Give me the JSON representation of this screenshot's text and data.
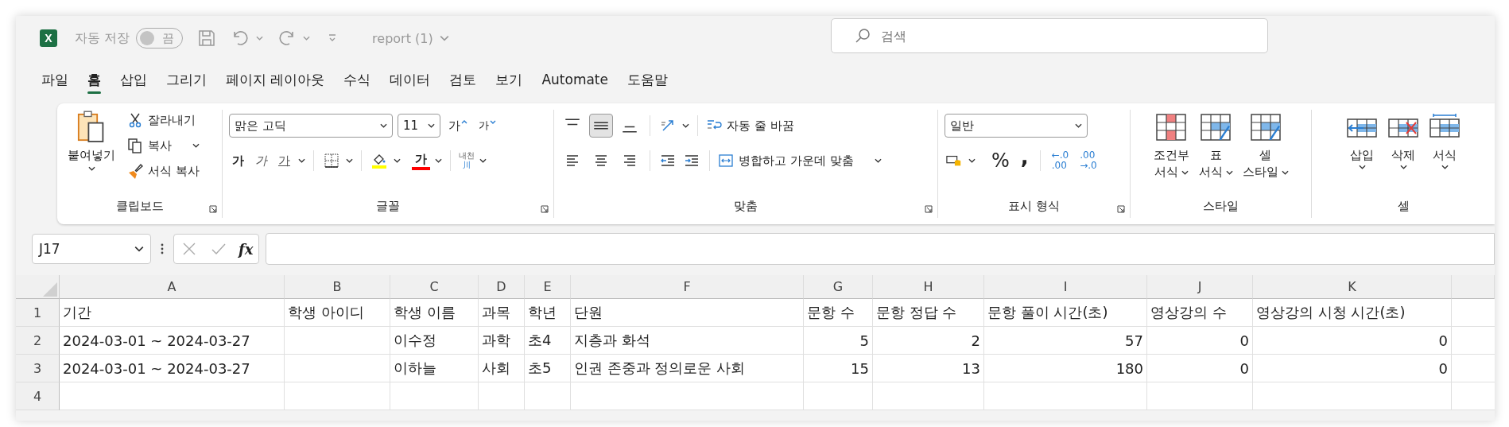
{
  "title_bar": {
    "app_logo": "X",
    "autosave_label": "자동 저장",
    "autosave_toggle": {
      "on": false,
      "label": "끔"
    },
    "document_title": "report (1)",
    "search": {
      "placeholder": "검색"
    }
  },
  "menu_tabs": [
    {
      "label": "파일",
      "selected": false
    },
    {
      "label": "홈",
      "selected": true
    },
    {
      "label": "삽입",
      "selected": false
    },
    {
      "label": "그리기",
      "selected": false
    },
    {
      "label": "페이지 레이아웃",
      "selected": false
    },
    {
      "label": "수식",
      "selected": false
    },
    {
      "label": "데이터",
      "selected": false
    },
    {
      "label": "검토",
      "selected": false
    },
    {
      "label": "보기",
      "selected": false
    },
    {
      "label": "Automate",
      "selected": false
    },
    {
      "label": "도움말",
      "selected": false
    }
  ],
  "ribbon": {
    "groups": [
      {
        "kind": "clipboard",
        "label": "클립보드",
        "launcher": true,
        "paste": "붙여넣기",
        "cut": "잘라내기",
        "copy": "복사",
        "format_painter": "서식 복사"
      },
      {
        "kind": "font",
        "label": "글꼴",
        "launcher": true,
        "font": "맑은 고딕",
        "size": "11",
        "grow": "가",
        "shrink": "가",
        "bold": "가",
        "italic": "가",
        "underline": "가",
        "font_color": "가",
        "phonetic": [
          "내천",
          "川"
        ]
      },
      {
        "kind": "alignment",
        "label": "맞춤",
        "launcher": true,
        "vertical": [
          {
            "selected": false
          },
          {
            "selected": true
          },
          {
            "selected": false
          }
        ],
        "horizontal": [
          {
            "selected": false
          },
          {
            "selected": false
          },
          {
            "selected": false
          }
        ],
        "wrap": "자동 줄 바꿈",
        "merge": "병합하고 가운데 맞춤"
      },
      {
        "kind": "number",
        "label": "표시 형식",
        "launcher": true,
        "format": "일반",
        "percent": "%",
        "comma": ",",
        "decimals": [
          {
            "lines": [
              "←.0",
              ".00"
            ]
          },
          {
            "lines": [
              ".00",
              "→.0"
            ]
          }
        ]
      },
      {
        "kind": "styles",
        "label": "스타일",
        "launcher": false,
        "buttons": [
          {
            "lines": [
              "조건부",
              "서식"
            ]
          },
          {
            "lines": [
              "표",
              "서식"
            ]
          },
          {
            "lines": [
              "셀",
              "스타일"
            ]
          }
        ]
      },
      {
        "kind": "cells",
        "label": "셀",
        "launcher": false,
        "buttons": [
          {
            "label": "삽입"
          },
          {
            "label": "삭제"
          },
          {
            "label": "서식"
          }
        ]
      }
    ]
  },
  "formula_bar": {
    "name_box": "J17",
    "function_label": "fx"
  },
  "sheet": {
    "columns": [
      {
        "letter": "A",
        "kind": "text"
      },
      {
        "letter": "B",
        "kind": "text"
      },
      {
        "letter": "C",
        "kind": "text"
      },
      {
        "letter": "D",
        "kind": "text"
      },
      {
        "letter": "E",
        "kind": "text"
      },
      {
        "letter": "F",
        "kind": "text"
      },
      {
        "letter": "G",
        "kind": "number"
      },
      {
        "letter": "H",
        "kind": "number"
      },
      {
        "letter": "I",
        "kind": "number"
      },
      {
        "letter": "J",
        "kind": "number"
      },
      {
        "letter": "K",
        "kind": "number"
      }
    ],
    "rows": [
      {
        "number": "1",
        "kind": "header",
        "cells": [
          "기간",
          "학생 아이디",
          "학생 이름",
          "과목",
          "학년",
          "단원",
          "문항 수",
          "문항 정답 수",
          "문항 풀이 시간(초)",
          "영상강의 수",
          "영상강의 시청 시간(초)"
        ]
      },
      {
        "number": "2",
        "kind": "data",
        "cells": [
          "2024-03-01 ~ 2024-03-27",
          null,
          "이수정",
          "과학",
          "초4",
          "지층과 화석",
          "5",
          "2",
          "57",
          "0",
          "0"
        ]
      },
      {
        "number": "3",
        "kind": "data",
        "cells": [
          "2024-03-01 ~ 2024-03-27",
          null,
          "이하늘",
          "사회",
          "초5",
          "인권 존중과 정의로운 사회",
          "15",
          "13",
          "180",
          "0",
          "0"
        ]
      },
      {
        "number": "4",
        "kind": "data"
      }
    ]
  }
}
